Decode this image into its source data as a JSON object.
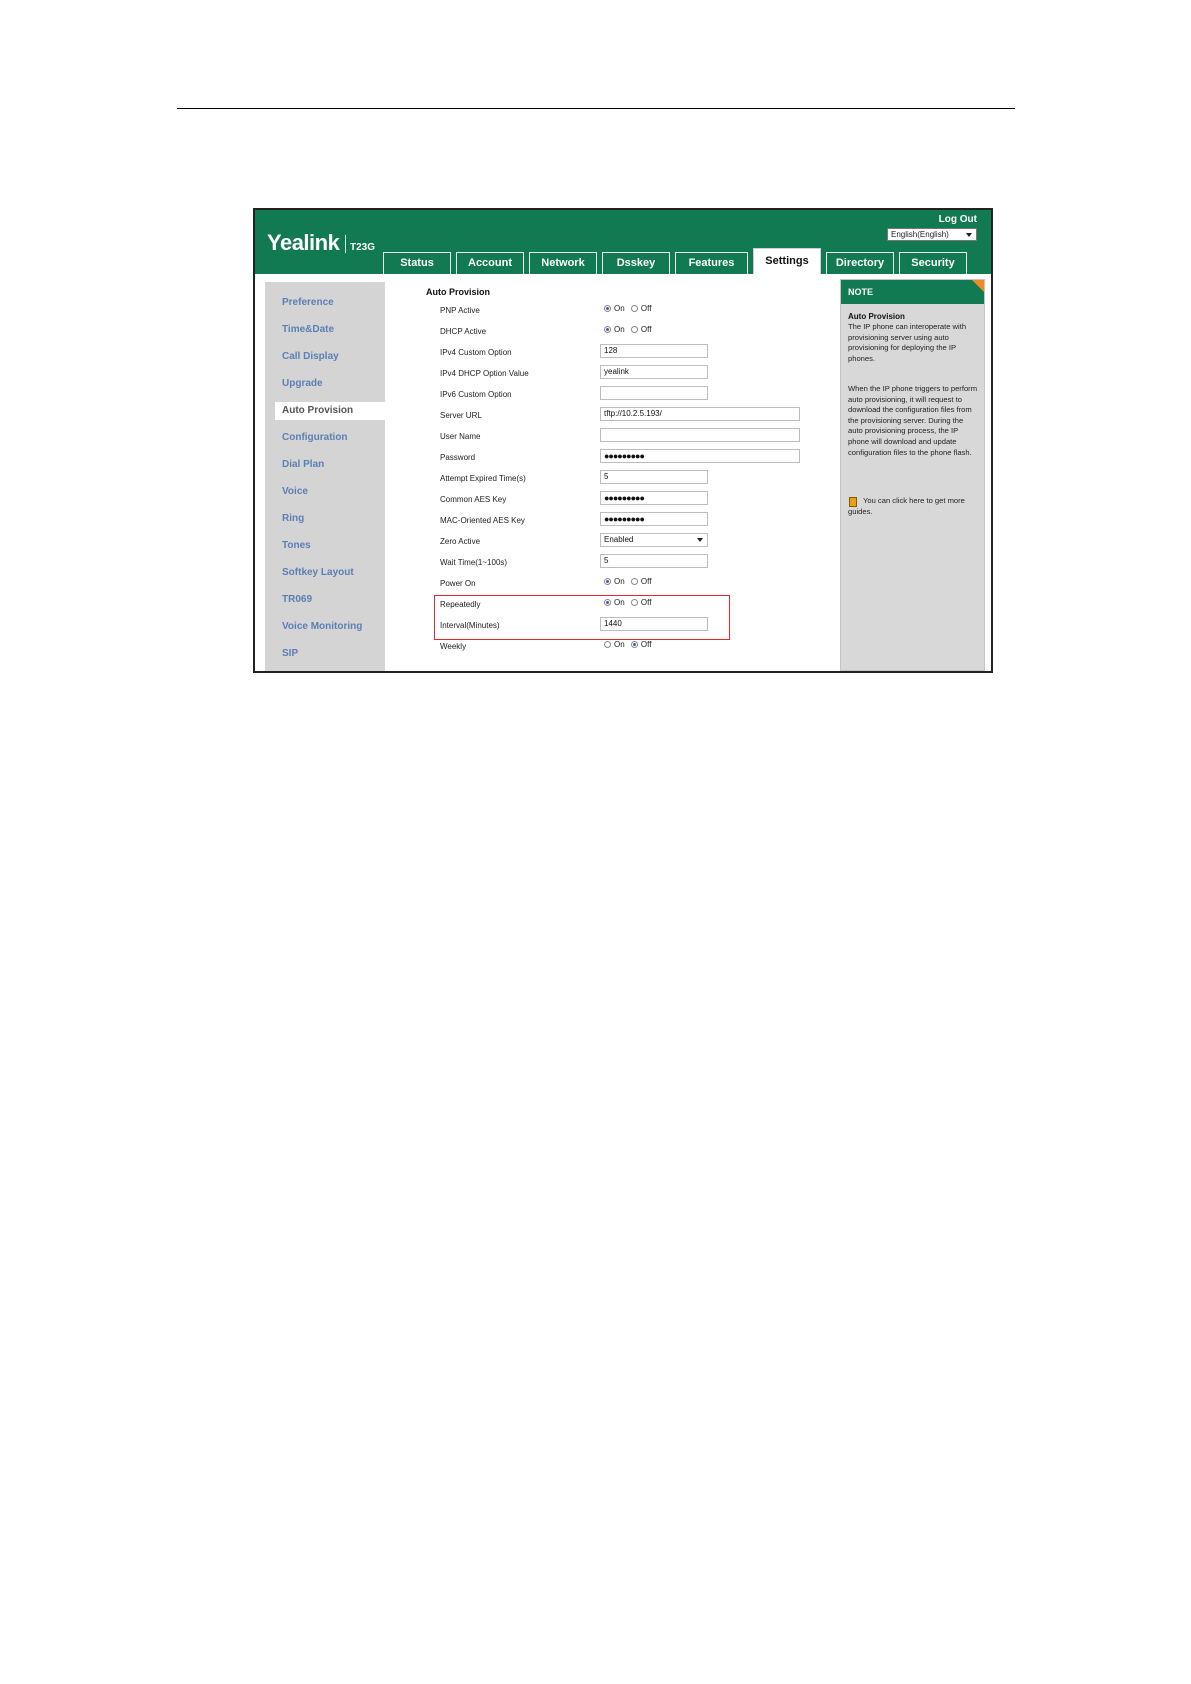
{
  "app": {
    "logo": "Yealink",
    "model": "T23G",
    "logout": "Log Out",
    "language": "English(English)"
  },
  "tabs": [
    "Status",
    "Account",
    "Network",
    "Dsskey",
    "Features",
    "Settings",
    "Directory",
    "Security"
  ],
  "active_tab": "Settings",
  "sidebar": [
    "Preference",
    "Time&Date",
    "Call Display",
    "Upgrade",
    "Auto Provision",
    "Configuration",
    "Dial Plan",
    "Voice",
    "Ring",
    "Tones",
    "Softkey Layout",
    "TR069",
    "Voice Monitoring",
    "SIP"
  ],
  "active_sidebar": "Auto Provision",
  "section_title": "Auto Provision",
  "radio_on": "On",
  "radio_off": "Off",
  "form": {
    "pnp_active": {
      "label": "PNP Active",
      "value": "On"
    },
    "dhcp_active": {
      "label": "DHCP Active",
      "value": "On"
    },
    "ipv4_custom_option": {
      "label": "IPv4 Custom Option",
      "value": "128"
    },
    "ipv4_dhcp_option_value": {
      "label": "IPv4 DHCP Option Value",
      "value": "yealink"
    },
    "ipv6_custom_option": {
      "label": "IPv6 Custom Option",
      "value": ""
    },
    "server_url": {
      "label": "Server URL",
      "value": "tftp://10.2.5.193/"
    },
    "user_name": {
      "label": "User Name",
      "value": ""
    },
    "password": {
      "label": "Password",
      "value": "●●●●●●●●●"
    },
    "attempt_expired_time": {
      "label": "Attempt Expired Time(s)",
      "value": "5"
    },
    "common_aes_key": {
      "label": "Common AES Key",
      "value": "●●●●●●●●●"
    },
    "mac_oriented_aes_key": {
      "label": "MAC-Oriented AES Key",
      "value": "●●●●●●●●●"
    },
    "zero_active": {
      "label": "Zero Active",
      "value": "Enabled"
    },
    "wait_time": {
      "label": "Wait Time(1~100s)",
      "value": "5"
    },
    "power_on": {
      "label": "Power On",
      "value": "On"
    },
    "repeatedly": {
      "label": "Repeatedly",
      "value": "On"
    },
    "interval": {
      "label": "Interval(Minutes)",
      "value": "1440"
    },
    "weekly": {
      "label": "Weekly",
      "value": "Off"
    }
  },
  "note": {
    "header": "NOTE",
    "title": "Auto Provision",
    "para1": "The IP phone can interoperate with provisioning server using auto provisioning for deploying the IP phones.",
    "para2": "When the IP phone triggers to perform auto provisioning, it will request to download the configuration files from the provisioning server. During the auto provisioning process, the IP phone will download and update configuration files to the phone flash.",
    "guide": "You can click here to get more guides."
  }
}
